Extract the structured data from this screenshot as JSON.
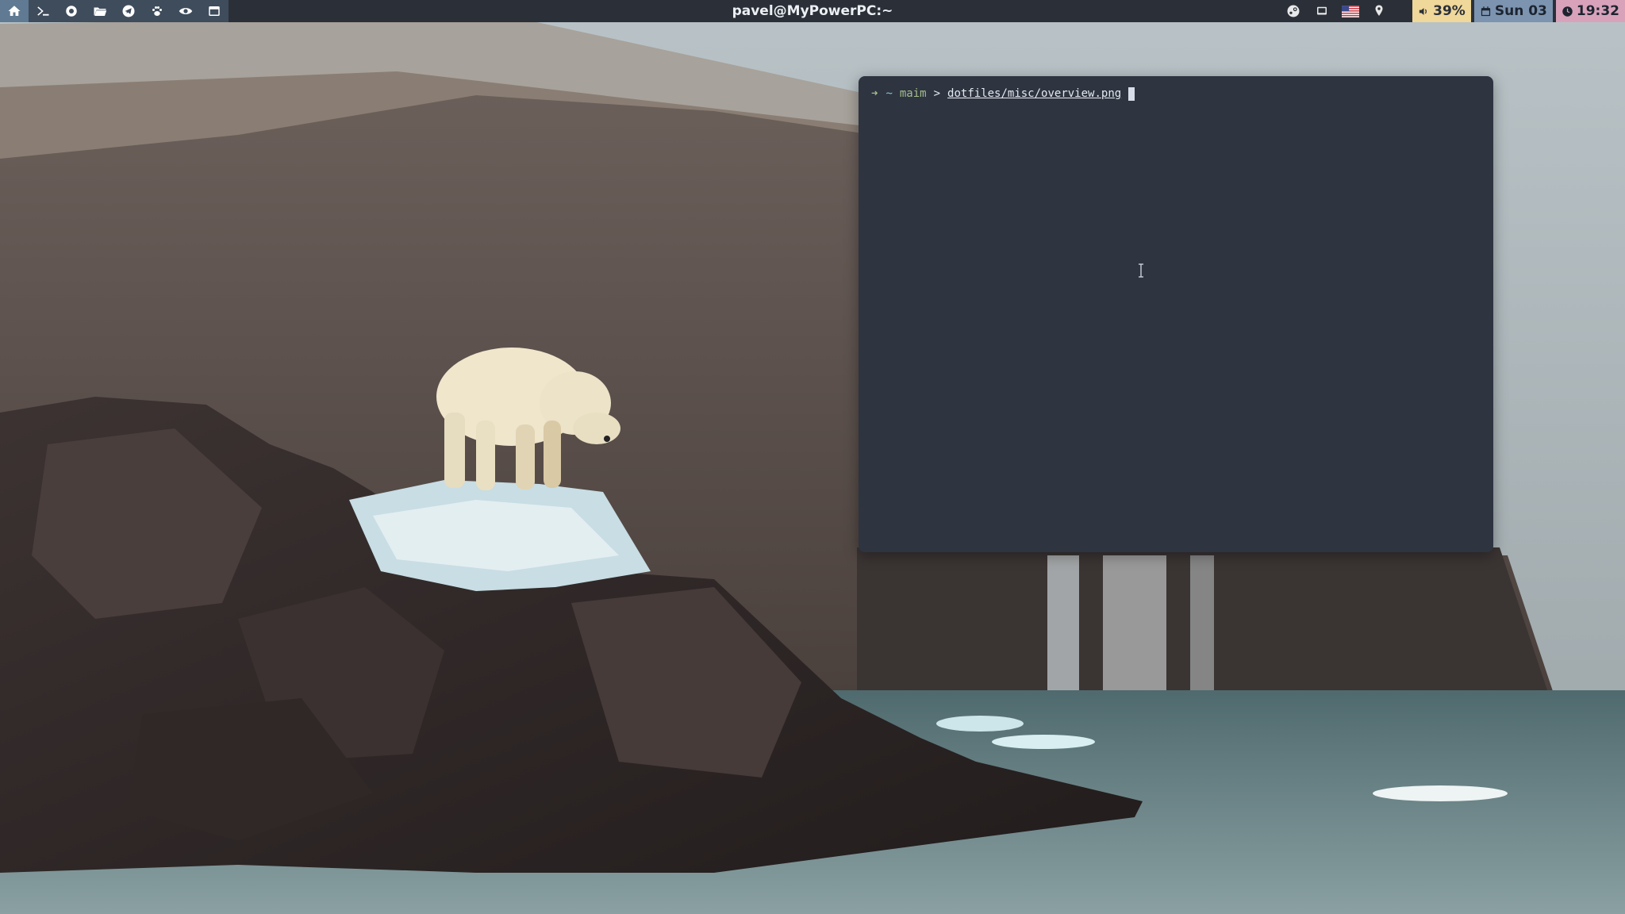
{
  "topbar": {
    "workspaces": [
      {
        "icon": "home-icon",
        "active": true
      },
      {
        "icon": "terminal-icon",
        "active": false
      },
      {
        "icon": "browser-icon",
        "active": false
      },
      {
        "icon": "folder-icon",
        "active": false
      },
      {
        "icon": "telegram-icon",
        "active": false
      },
      {
        "icon": "paw-icon",
        "active": false
      },
      {
        "icon": "eye-icon",
        "active": false
      },
      {
        "icon": "window-icon",
        "active": false
      }
    ],
    "window_title": "pavel@MyPowerPC:~",
    "tray": [
      {
        "icon": "steam-icon"
      },
      {
        "icon": "display-icon"
      },
      {
        "icon": "us-flag-icon"
      },
      {
        "icon": "location-pin-icon"
      }
    ],
    "volume": {
      "icon": "speaker-icon",
      "label": "39%"
    },
    "date": {
      "icon": "calendar-icon",
      "label": "Sun 03"
    },
    "time": {
      "icon": "clock-icon",
      "label": "19:32"
    },
    "colors": {
      "bar_bg": "#2b3038",
      "active_ws": "#5f7a92",
      "volume_bg": "#f0d79a",
      "date_bg": "#7c94b0",
      "time_bg": "#d8a2bb"
    }
  },
  "terminal": {
    "prompt_arrow": "➜",
    "cwd": "~",
    "branch": "maim",
    "separator": ">",
    "command": "dotfiles/misc/overview.png",
    "colors": {
      "bg": "#2e3440",
      "arrow": "#a3be8c",
      "cwd": "#88c0d0",
      "text": "#e5e9f0"
    }
  }
}
